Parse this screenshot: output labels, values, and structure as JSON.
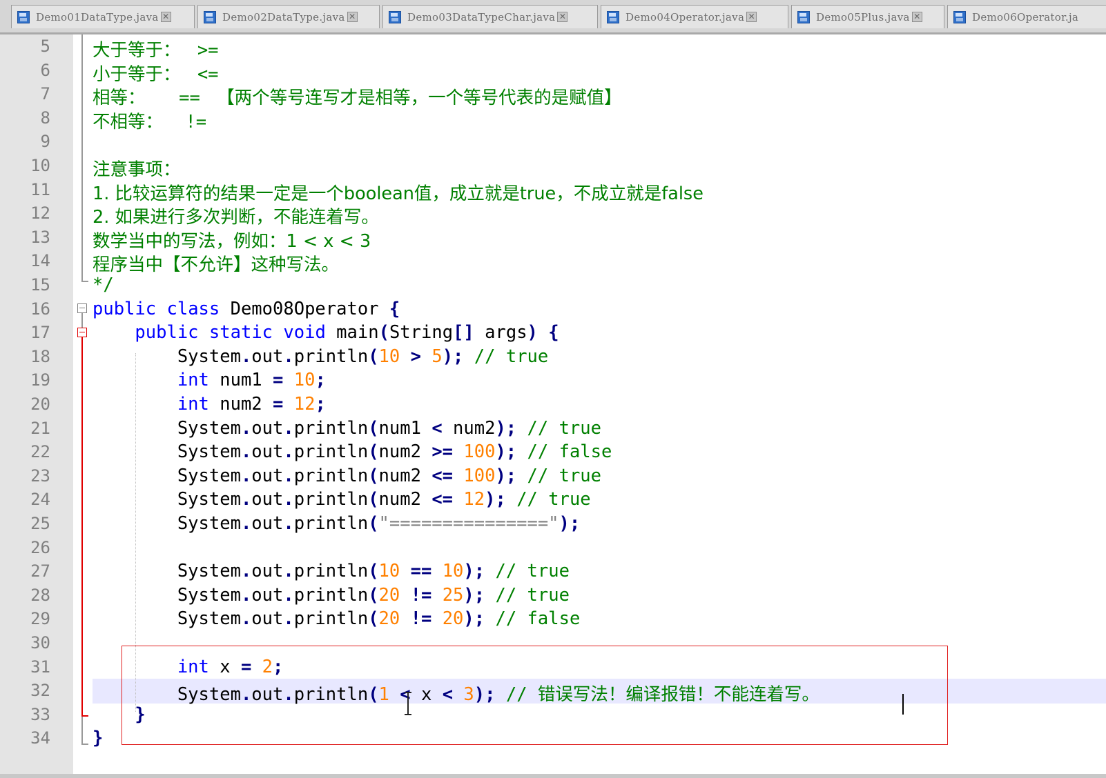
{
  "tabs": [
    {
      "label": "Demo01DataType.java"
    },
    {
      "label": "Demo02DataType.java"
    },
    {
      "label": "Demo03DataTypeChar.java"
    },
    {
      "label": "Demo04Operator.java"
    },
    {
      "label": "Demo05Plus.java"
    },
    {
      "label": "Demo06Operator.ja"
    }
  ],
  "icons": {
    "file": "java-file-icon",
    "close": "close-icon"
  },
  "colors": {
    "keyword": "#0000ff",
    "comment": "#008000",
    "number": "#ff8000",
    "operator": "#000080",
    "string": "#808080",
    "annotation": "#e02020",
    "current_line": "#e8e8ff"
  },
  "lines": [
    {
      "n": "5",
      "tokens": [
        [
          "cmz",
          "大于等于：   "
        ],
        [
          "cm",
          ">="
        ]
      ]
    },
    {
      "n": "6",
      "tokens": [
        [
          "cmz",
          "小于等于：   "
        ],
        [
          "cm",
          "<="
        ]
      ]
    },
    {
      "n": "7",
      "tokens": [
        [
          "cmz",
          "相等：      "
        ],
        [
          "cm",
          "=="
        ],
        [
          "cmz",
          "   【两个等号连写才是相等，一个等号代表的是赋值】"
        ]
      ]
    },
    {
      "n": "8",
      "tokens": [
        [
          "cmz",
          "不相等：    "
        ],
        [
          "cm",
          "!="
        ]
      ]
    },
    {
      "n": "9",
      "tokens": []
    },
    {
      "n": "10",
      "tokens": [
        [
          "cmz",
          "注意事项："
        ]
      ]
    },
    {
      "n": "11",
      "tokens": [
        [
          "cmz",
          "1. 比较运算符的结果一定是一个boolean值，成立就是true，不成立就是false"
        ]
      ]
    },
    {
      "n": "12",
      "tokens": [
        [
          "cmz",
          "2. 如果进行多次判断，不能连着写。"
        ]
      ]
    },
    {
      "n": "13",
      "tokens": [
        [
          "cmz",
          "数学当中的写法，例如：1 < x < 3"
        ]
      ]
    },
    {
      "n": "14",
      "tokens": [
        [
          "cmz",
          "程序当中【不允许】这种写法。"
        ]
      ]
    },
    {
      "n": "15",
      "tokens": [
        [
          "cm",
          "*/"
        ]
      ]
    },
    {
      "n": "16",
      "tokens": [
        [
          "kw",
          "public"
        ],
        [
          "pl",
          " "
        ],
        [
          "kw",
          "class"
        ],
        [
          "pl",
          " Demo08Operator "
        ],
        [
          "op",
          "{"
        ]
      ]
    },
    {
      "n": "17",
      "tokens": [
        [
          "pl",
          "    "
        ],
        [
          "kw",
          "public"
        ],
        [
          "pl",
          " "
        ],
        [
          "kw",
          "static"
        ],
        [
          "pl",
          " "
        ],
        [
          "kw",
          "void"
        ],
        [
          "pl",
          " main"
        ],
        [
          "op",
          "("
        ],
        [
          "pl",
          "String"
        ],
        [
          "op",
          "[]"
        ],
        [
          "pl",
          " args"
        ],
        [
          "op",
          ")"
        ],
        [
          "pl",
          " "
        ],
        [
          "op",
          "{"
        ]
      ]
    },
    {
      "n": "18",
      "tokens": [
        [
          "pl",
          "        System"
        ],
        [
          "op",
          "."
        ],
        [
          "pl",
          "out"
        ],
        [
          "op",
          "."
        ],
        [
          "pl",
          "println"
        ],
        [
          "op",
          "("
        ],
        [
          "num",
          "10"
        ],
        [
          "pl",
          " "
        ],
        [
          "op",
          ">"
        ],
        [
          "pl",
          " "
        ],
        [
          "num",
          "5"
        ],
        [
          "op",
          ");"
        ],
        [
          "pl",
          " "
        ],
        [
          "cm",
          "// true"
        ]
      ]
    },
    {
      "n": "19",
      "tokens": [
        [
          "pl",
          "        "
        ],
        [
          "kw",
          "int"
        ],
        [
          "pl",
          " num1 "
        ],
        [
          "op",
          "="
        ],
        [
          "pl",
          " "
        ],
        [
          "num",
          "10"
        ],
        [
          "op",
          ";"
        ]
      ]
    },
    {
      "n": "20",
      "tokens": [
        [
          "pl",
          "        "
        ],
        [
          "kw",
          "int"
        ],
        [
          "pl",
          " num2 "
        ],
        [
          "op",
          "="
        ],
        [
          "pl",
          " "
        ],
        [
          "num",
          "12"
        ],
        [
          "op",
          ";"
        ]
      ]
    },
    {
      "n": "21",
      "tokens": [
        [
          "pl",
          "        System"
        ],
        [
          "op",
          "."
        ],
        [
          "pl",
          "out"
        ],
        [
          "op",
          "."
        ],
        [
          "pl",
          "println"
        ],
        [
          "op",
          "("
        ],
        [
          "pl",
          "num1 "
        ],
        [
          "op",
          "<"
        ],
        [
          "pl",
          " num2"
        ],
        [
          "op",
          ");"
        ],
        [
          "pl",
          " "
        ],
        [
          "cm",
          "// true"
        ]
      ]
    },
    {
      "n": "22",
      "tokens": [
        [
          "pl",
          "        System"
        ],
        [
          "op",
          "."
        ],
        [
          "pl",
          "out"
        ],
        [
          "op",
          "."
        ],
        [
          "pl",
          "println"
        ],
        [
          "op",
          "("
        ],
        [
          "pl",
          "num2 "
        ],
        [
          "op",
          ">="
        ],
        [
          "pl",
          " "
        ],
        [
          "num",
          "100"
        ],
        [
          "op",
          ");"
        ],
        [
          "pl",
          " "
        ],
        [
          "cm",
          "// false"
        ]
      ]
    },
    {
      "n": "23",
      "tokens": [
        [
          "pl",
          "        System"
        ],
        [
          "op",
          "."
        ],
        [
          "pl",
          "out"
        ],
        [
          "op",
          "."
        ],
        [
          "pl",
          "println"
        ],
        [
          "op",
          "("
        ],
        [
          "pl",
          "num2 "
        ],
        [
          "op",
          "<="
        ],
        [
          "pl",
          " "
        ],
        [
          "num",
          "100"
        ],
        [
          "op",
          ");"
        ],
        [
          "pl",
          " "
        ],
        [
          "cm",
          "// true"
        ]
      ]
    },
    {
      "n": "24",
      "tokens": [
        [
          "pl",
          "        System"
        ],
        [
          "op",
          "."
        ],
        [
          "pl",
          "out"
        ],
        [
          "op",
          "."
        ],
        [
          "pl",
          "println"
        ],
        [
          "op",
          "("
        ],
        [
          "pl",
          "num2 "
        ],
        [
          "op",
          "<="
        ],
        [
          "pl",
          " "
        ],
        [
          "num",
          "12"
        ],
        [
          "op",
          ");"
        ],
        [
          "pl",
          " "
        ],
        [
          "cm",
          "// true"
        ]
      ]
    },
    {
      "n": "25",
      "tokens": [
        [
          "pl",
          "        System"
        ],
        [
          "op",
          "."
        ],
        [
          "pl",
          "out"
        ],
        [
          "op",
          "."
        ],
        [
          "pl",
          "println"
        ],
        [
          "op",
          "("
        ],
        [
          "str",
          "\"===============\""
        ],
        [
          "op",
          ");"
        ]
      ]
    },
    {
      "n": "26",
      "tokens": []
    },
    {
      "n": "27",
      "tokens": [
        [
          "pl",
          "        System"
        ],
        [
          "op",
          "."
        ],
        [
          "pl",
          "out"
        ],
        [
          "op",
          "."
        ],
        [
          "pl",
          "println"
        ],
        [
          "op",
          "("
        ],
        [
          "num",
          "10"
        ],
        [
          "pl",
          " "
        ],
        [
          "op",
          "=="
        ],
        [
          "pl",
          " "
        ],
        [
          "num",
          "10"
        ],
        [
          "op",
          ");"
        ],
        [
          "pl",
          " "
        ],
        [
          "cm",
          "// true"
        ]
      ]
    },
    {
      "n": "28",
      "tokens": [
        [
          "pl",
          "        System"
        ],
        [
          "op",
          "."
        ],
        [
          "pl",
          "out"
        ],
        [
          "op",
          "."
        ],
        [
          "pl",
          "println"
        ],
        [
          "op",
          "("
        ],
        [
          "num",
          "20"
        ],
        [
          "pl",
          " "
        ],
        [
          "op",
          "!="
        ],
        [
          "pl",
          " "
        ],
        [
          "num",
          "25"
        ],
        [
          "op",
          ");"
        ],
        [
          "pl",
          " "
        ],
        [
          "cm",
          "// true"
        ]
      ]
    },
    {
      "n": "29",
      "tokens": [
        [
          "pl",
          "        System"
        ],
        [
          "op",
          "."
        ],
        [
          "pl",
          "out"
        ],
        [
          "op",
          "."
        ],
        [
          "pl",
          "println"
        ],
        [
          "op",
          "("
        ],
        [
          "num",
          "20"
        ],
        [
          "pl",
          " "
        ],
        [
          "op",
          "!="
        ],
        [
          "pl",
          " "
        ],
        [
          "num",
          "20"
        ],
        [
          "op",
          ");"
        ],
        [
          "pl",
          " "
        ],
        [
          "cm",
          "// false"
        ]
      ]
    },
    {
      "n": "30",
      "tokens": []
    },
    {
      "n": "31",
      "tokens": [
        [
          "pl",
          "        "
        ],
        [
          "kw",
          "int"
        ],
        [
          "pl",
          " x "
        ],
        [
          "op",
          "="
        ],
        [
          "pl",
          " "
        ],
        [
          "num",
          "2"
        ],
        [
          "op",
          ";"
        ]
      ]
    },
    {
      "n": "32",
      "tokens": [
        [
          "pl",
          "        System"
        ],
        [
          "op",
          "."
        ],
        [
          "pl",
          "out"
        ],
        [
          "op",
          "."
        ],
        [
          "pl",
          "println"
        ],
        [
          "op",
          "("
        ],
        [
          "num",
          "1"
        ],
        [
          "pl",
          " "
        ],
        [
          "op",
          "<"
        ],
        [
          "pl",
          " x "
        ],
        [
          "op",
          "<"
        ],
        [
          "pl",
          " "
        ],
        [
          "num",
          "3"
        ],
        [
          "op",
          ");"
        ],
        [
          "pl",
          " "
        ],
        [
          "cm",
          "// "
        ],
        [
          "cmz",
          "错误写法！编译报错！不能连着写。"
        ]
      ]
    },
    {
      "n": "33",
      "tokens": [
        [
          "pl",
          "    "
        ],
        [
          "op",
          "}"
        ]
      ]
    },
    {
      "n": "34",
      "tokens": [
        [
          "op",
          "}"
        ]
      ]
    }
  ]
}
